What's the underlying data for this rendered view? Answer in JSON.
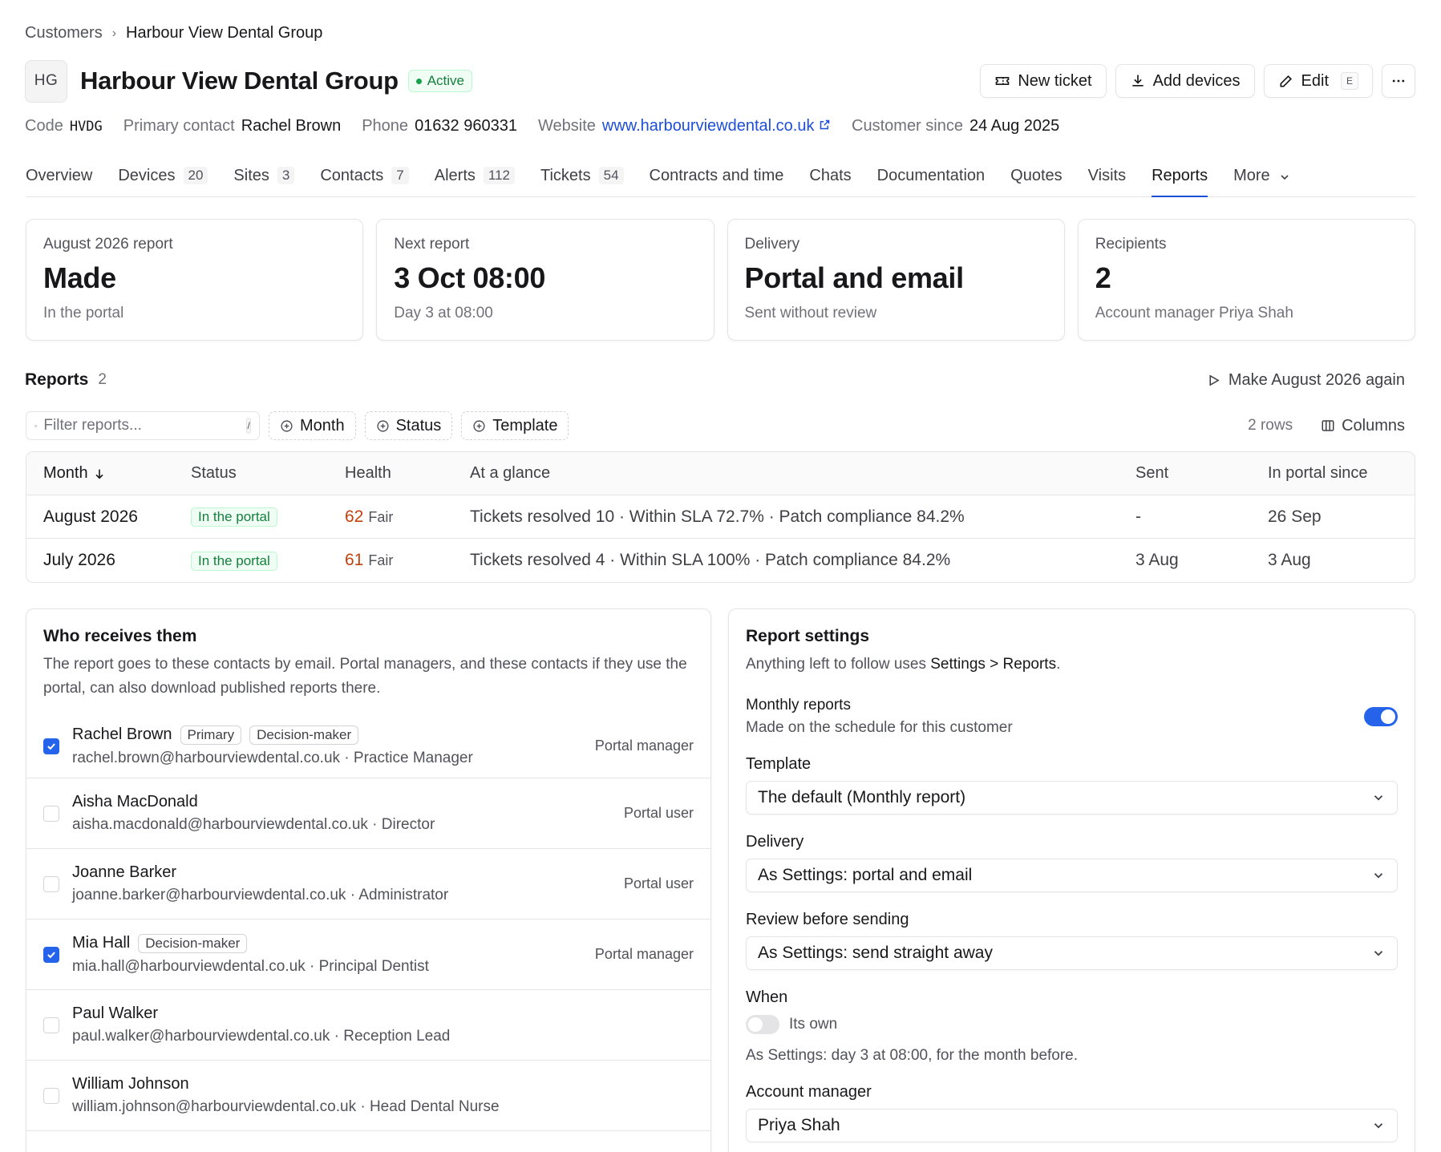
{
  "breadcrumb": {
    "parent": "Customers",
    "current": "Harbour View Dental Group"
  },
  "customer": {
    "initials": "HG",
    "name": "Harbour View Dental Group",
    "status": "Active"
  },
  "actions": {
    "new_ticket": "New ticket",
    "add_devices": "Add devices",
    "edit": "Edit",
    "edit_shortcut": "E"
  },
  "meta": {
    "code_label": "Code",
    "code": "HVDG",
    "contact_label": "Primary contact",
    "contact": "Rachel Brown",
    "phone_label": "Phone",
    "phone": "01632 960331",
    "website_label": "Website",
    "website": "www.harbourviewdental.co.uk",
    "since_label": "Customer since",
    "since": "24 Aug 2025"
  },
  "tabs": [
    {
      "label": "Overview",
      "count": ""
    },
    {
      "label": "Devices",
      "count": "20"
    },
    {
      "label": "Sites",
      "count": "3"
    },
    {
      "label": "Contacts",
      "count": "7"
    },
    {
      "label": "Alerts",
      "count": "112"
    },
    {
      "label": "Tickets",
      "count": "54"
    },
    {
      "label": "Contracts and time",
      "count": ""
    },
    {
      "label": "Chats",
      "count": ""
    },
    {
      "label": "Documentation",
      "count": ""
    },
    {
      "label": "Quotes",
      "count": ""
    },
    {
      "label": "Visits",
      "count": ""
    },
    {
      "label": "Reports",
      "count": ""
    },
    {
      "label": "More",
      "count": ""
    }
  ],
  "cards": [
    {
      "label": "August 2026 report",
      "value": "Made",
      "sub": "In the portal"
    },
    {
      "label": "Next report",
      "value": "3 Oct 08:00",
      "sub": "Day 3 at 08:00"
    },
    {
      "label": "Delivery",
      "value": "Portal and email",
      "sub": "Sent without review"
    },
    {
      "label": "Recipients",
      "value": "2",
      "sub": "Account manager Priya Shah"
    }
  ],
  "reports": {
    "heading": "Reports",
    "count": "2",
    "make_again": "Make August 2026 again",
    "filter_placeholder": "Filter reports...",
    "filter_shortcut": "/",
    "chips": [
      "Month",
      "Status",
      "Template"
    ],
    "rows_label": "2 rows",
    "columns_label": "Columns",
    "headers": {
      "month": "Month",
      "status": "Status",
      "health": "Health",
      "glance": "At a glance",
      "sent": "Sent",
      "portal": "In portal since"
    },
    "rows": [
      {
        "month": "August 2026",
        "status": "In the portal",
        "health": "62",
        "health_label": "Fair",
        "glance": "Tickets resolved 10 · Within SLA 72.7% · Patch compliance 84.2%",
        "sent": "-",
        "portal": "26 Sep"
      },
      {
        "month": "July 2026",
        "status": "In the portal",
        "health": "61",
        "health_label": "Fair",
        "glance": "Tickets resolved 4 · Within SLA 100% · Patch compliance 84.2%",
        "sent": "3 Aug",
        "portal": "3 Aug"
      }
    ]
  },
  "recipients": {
    "title": "Who receives them",
    "desc": "The report goes to these contacts by email. Portal managers, and these contacts if they use the portal, can also download published reports there.",
    "list": [
      {
        "name": "Rachel Brown",
        "tags": [
          "Primary",
          "Decision-maker"
        ],
        "sub": "rachel.brown@harbourviewdental.co.uk · Practice Manager",
        "role": "Portal manager",
        "checked": true
      },
      {
        "name": "Aisha MacDonald",
        "tags": [],
        "sub": "aisha.macdonald@harbourviewdental.co.uk · Director",
        "role": "Portal user",
        "checked": false
      },
      {
        "name": "Joanne Barker",
        "tags": [],
        "sub": "joanne.barker@harbourviewdental.co.uk · Administrator",
        "role": "Portal user",
        "checked": false
      },
      {
        "name": "Mia Hall",
        "tags": [
          "Decision-maker"
        ],
        "sub": "mia.hall@harbourviewdental.co.uk · Principal Dentist",
        "role": "Portal manager",
        "checked": true
      },
      {
        "name": "Paul Walker",
        "tags": [],
        "sub": "paul.walker@harbourviewdental.co.uk · Reception Lead",
        "role": "",
        "checked": false
      },
      {
        "name": "William Johnson",
        "tags": [],
        "sub": "william.johnson@harbourviewdental.co.uk · Head Dental Nurse",
        "role": "",
        "checked": false
      }
    ]
  },
  "settings": {
    "title": "Report settings",
    "desc_prefix": "Anything left to follow uses",
    "desc_link": "Settings > Reports",
    "desc_suffix": ".",
    "monthly_label": "Monthly reports",
    "monthly_sub": "Made on the schedule for this customer",
    "monthly_on": true,
    "template_label": "Template",
    "template_value": "The default (Monthly report)",
    "delivery_label": "Delivery",
    "delivery_value": "As Settings: portal and email",
    "review_label": "Review before sending",
    "review_value": "As Settings: send straight away",
    "when_label": "When",
    "when_toggle": "Its own",
    "when_note": "As Settings: day 3 at 08:00, for the month before.",
    "am_label": "Account manager",
    "am_value": "Priya Shah"
  },
  "colors": {
    "accent": "#2563eb",
    "active_green": "#15803d",
    "health_orange": "#c2410c"
  }
}
